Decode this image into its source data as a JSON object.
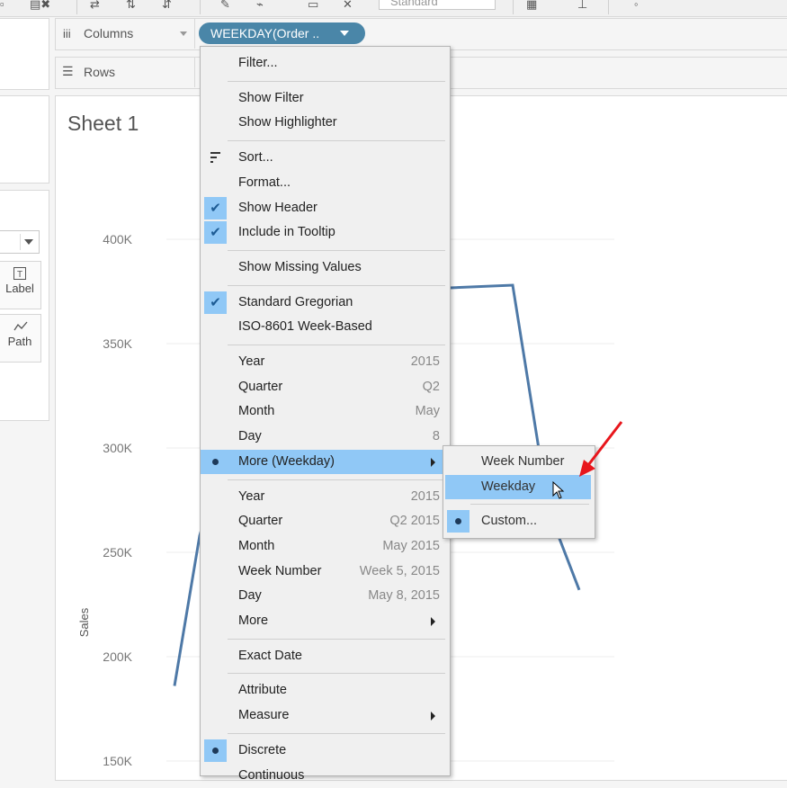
{
  "toolbar": {
    "format_box_text": "Standard"
  },
  "left_panel": {
    "marks": [
      {
        "label": "Label",
        "icon": "label-icon"
      },
      {
        "label": "Path",
        "icon": "path-icon"
      }
    ]
  },
  "shelves": {
    "columns_label": "Columns",
    "rows_label": "Rows",
    "columns_pill": "WEEKDAY(Order .."
  },
  "sheet": {
    "title": "Sheet 1"
  },
  "chart_data": {
    "type": "line",
    "ylabel": "Sales",
    "y_ticks": [
      "400K",
      "350K",
      "300K",
      "250K",
      "200K",
      "150K"
    ],
    "ylim": [
      150000,
      410000
    ],
    "grid": true,
    "series": [
      {
        "color": "#4e79a7",
        "points_visible": [
          {
            "x": "1",
            "y": 186000
          },
          {
            "x": "2",
            "y": 258000
          },
          {
            "x": "3",
            "y": 373000
          },
          {
            "x": "4",
            "y": 378000
          },
          {
            "x": "5",
            "y": 270000
          },
          {
            "x": "6",
            "y": 232000
          }
        ]
      }
    ]
  },
  "context_menu": {
    "items": [
      {
        "label": "Filter..."
      },
      {
        "separator": true
      },
      {
        "label": "Show Filter"
      },
      {
        "label": "Show Highlighter"
      },
      {
        "separator": true
      },
      {
        "label": "Sort...",
        "icon": "sort-icon"
      },
      {
        "label": "Format..."
      },
      {
        "label": "Show Header",
        "checked": true
      },
      {
        "label": "Include in Tooltip",
        "checked": true
      },
      {
        "separator": true
      },
      {
        "label": "Show Missing Values"
      },
      {
        "separator": true
      },
      {
        "label": "Standard Gregorian",
        "checked": true
      },
      {
        "label": "ISO-8601 Week-Based"
      },
      {
        "separator": true
      },
      {
        "label": "Year",
        "value": "2015"
      },
      {
        "label": "Quarter",
        "value": "Q2"
      },
      {
        "label": "Month",
        "value": "May"
      },
      {
        "label": "Day",
        "value": "8"
      },
      {
        "label": "More (Weekday)",
        "selected": true,
        "submenu": true,
        "highlight": true
      },
      {
        "separator": true
      },
      {
        "label": "Year",
        "value": "2015"
      },
      {
        "label": "Quarter",
        "value": "Q2 2015"
      },
      {
        "label": "Month",
        "value": "May 2015"
      },
      {
        "label": "Week Number",
        "value": "Week 5, 2015"
      },
      {
        "label": "Day",
        "value": "May 8, 2015"
      },
      {
        "label": "More",
        "submenu": true
      },
      {
        "separator": true
      },
      {
        "label": "Exact Date"
      },
      {
        "separator": true
      },
      {
        "label": "Attribute"
      },
      {
        "label": "Measure",
        "submenu": true
      },
      {
        "separator": true
      },
      {
        "label": "Discrete",
        "selected": true
      },
      {
        "label": "Continuous"
      }
    ]
  },
  "submenu": {
    "items": [
      {
        "label": "Week Number"
      },
      {
        "label": "Weekday",
        "highlight": true
      },
      {
        "separator": true
      },
      {
        "label": "Custom...",
        "selected": true
      }
    ]
  },
  "colors": {
    "pill": "#4a86a8",
    "highlight": "#90c8f6",
    "line": "#4e79a7",
    "annotation_arrow": "#e8161c"
  }
}
